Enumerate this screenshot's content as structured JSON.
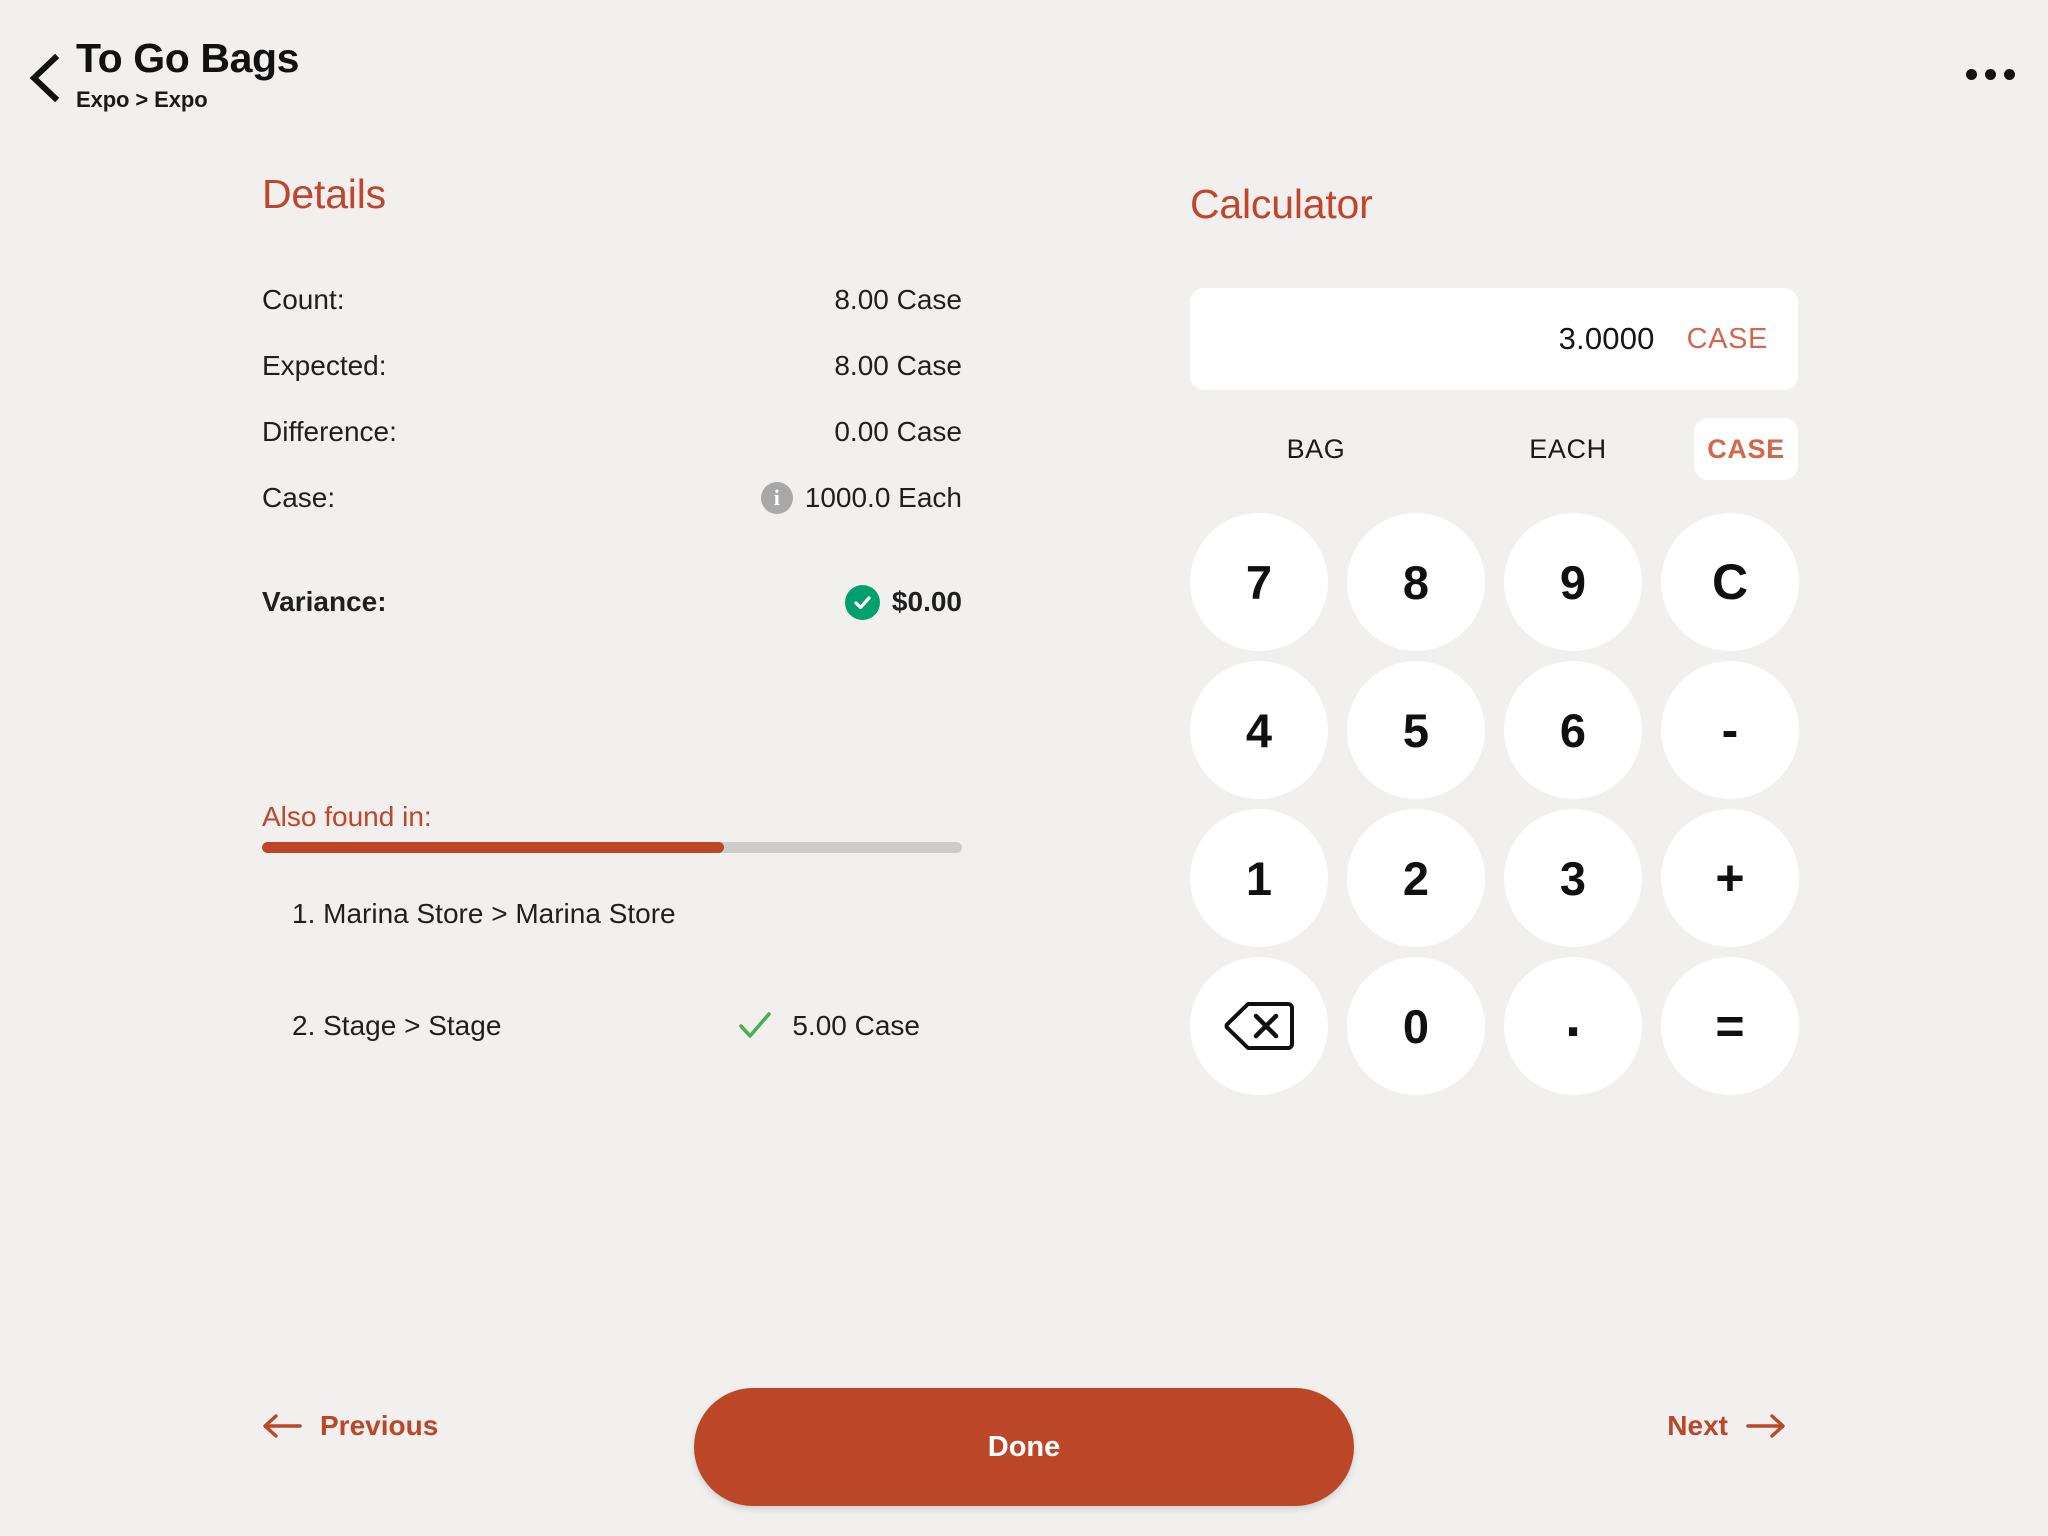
{
  "header": {
    "title": "To Go Bags",
    "breadcrumb": "Expo > Expo",
    "back_icon": "chevron-left-icon",
    "more_icon": "more-horizontal-icon"
  },
  "details": {
    "heading": "Details",
    "rows": [
      {
        "label": "Count:",
        "value": "8.00 Case",
        "icon": null
      },
      {
        "label": "Expected:",
        "value": "8.00 Case",
        "icon": null
      },
      {
        "label": "Difference:",
        "value": "0.00 Case",
        "icon": null
      },
      {
        "label": "Case:",
        "value": "1000.0 Each",
        "icon": "info-icon"
      }
    ],
    "variance": {
      "label": "Variance:",
      "value": "$0.00",
      "status_icon": "check-circle-icon",
      "status_color": "#00a06d"
    }
  },
  "also_found": {
    "title": "Also found in:",
    "progress_percent": 66,
    "progress_fill_color": "#bb4628",
    "progress_track_color": "#cccccc",
    "items": [
      {
        "name": "1. Marina Store > Marina Store",
        "qty": "",
        "icon": null
      },
      {
        "name": "2. Stage > Stage",
        "qty": "5.00 Case",
        "icon": "check-icon"
      }
    ]
  },
  "calculator": {
    "heading": "Calculator",
    "display_value": "3.0000",
    "display_unit": "CASE",
    "unit_tabs": [
      {
        "label": "BAG",
        "active": false
      },
      {
        "label": "EACH",
        "active": false
      },
      {
        "label": "CASE",
        "active": true
      }
    ],
    "keys": [
      {
        "label": "7",
        "name": "key-7",
        "kind": "digit"
      },
      {
        "label": "8",
        "name": "key-8",
        "kind": "digit"
      },
      {
        "label": "9",
        "name": "key-9",
        "kind": "digit"
      },
      {
        "label": "C",
        "name": "key-clear",
        "kind": "op"
      },
      {
        "label": "4",
        "name": "key-4",
        "kind": "digit"
      },
      {
        "label": "5",
        "name": "key-5",
        "kind": "digit"
      },
      {
        "label": "6",
        "name": "key-6",
        "kind": "digit"
      },
      {
        "label": "-",
        "name": "key-minus",
        "kind": "op"
      },
      {
        "label": "1",
        "name": "key-1",
        "kind": "digit"
      },
      {
        "label": "2",
        "name": "key-2",
        "kind": "digit"
      },
      {
        "label": "3",
        "name": "key-3",
        "kind": "digit"
      },
      {
        "label": "+",
        "name": "key-plus",
        "kind": "op"
      },
      {
        "label": "",
        "name": "key-backspace",
        "kind": "backspace-icon"
      },
      {
        "label": "0",
        "name": "key-0",
        "kind": "digit"
      },
      {
        "label": ".",
        "name": "key-decimal",
        "kind": "dot"
      },
      {
        "label": "=",
        "name": "key-equals",
        "kind": "op"
      }
    ]
  },
  "footer": {
    "previous_label": "Previous",
    "previous_icon": "arrow-left-icon",
    "done_label": "Done",
    "next_label": "Next",
    "next_icon": "arrow-right-icon",
    "accent_color": "#bb4628"
  }
}
